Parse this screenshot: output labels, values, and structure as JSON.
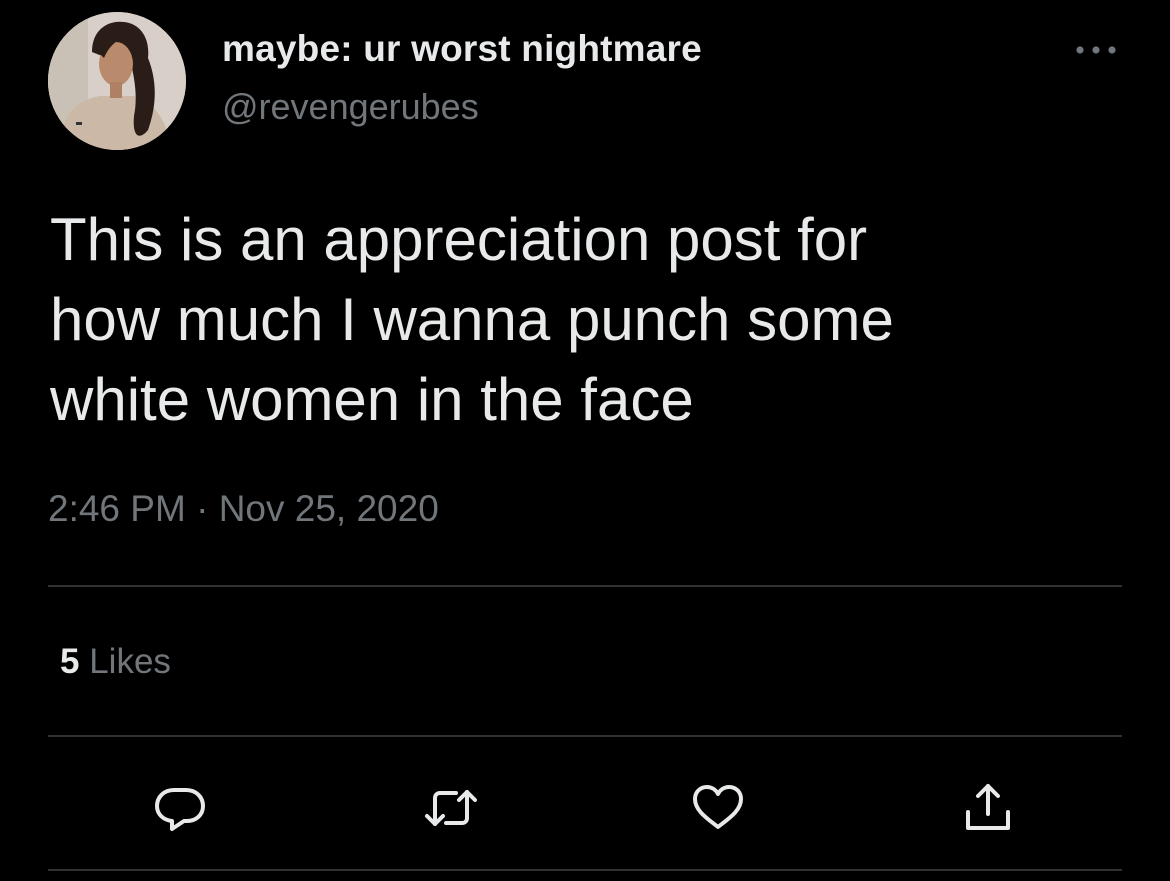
{
  "user": {
    "display_name": "maybe: ur worst nightmare",
    "handle": "@revengerubes",
    "avatar_icon": "profile-photo"
  },
  "tweet": {
    "text": "This is an appreciation post for\nhow much I wanna punch some\nwhite women in the face",
    "time": "2:46 PM",
    "separator": "·",
    "date": "Nov 25, 2020"
  },
  "stats": {
    "likes_count": "5",
    "likes_label": "Likes"
  },
  "actions": {
    "reply_icon": "reply-icon",
    "retweet_icon": "retweet-icon",
    "like_icon": "heart-icon",
    "share_icon": "share-icon",
    "more_icon": "more-icon"
  },
  "colors": {
    "background": "#000000",
    "primary_text": "#e7e9ea",
    "secondary_text": "#71767b",
    "divider": "#2f3336"
  }
}
